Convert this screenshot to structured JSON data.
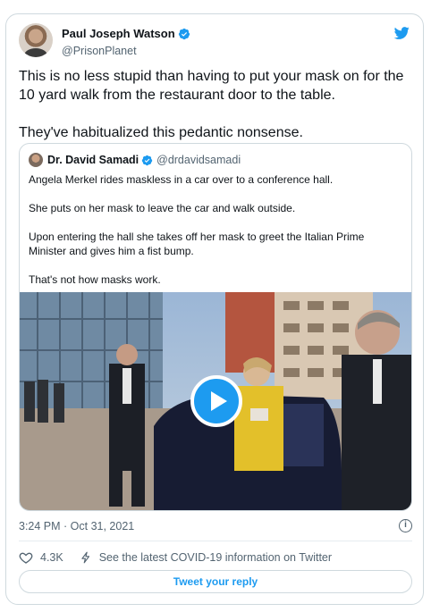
{
  "author": {
    "name": "Paul Joseph Watson",
    "handle": "@PrisonPlanet"
  },
  "tweet": {
    "paragraphs": [
      "This is no less stupid than having to put your mask on for the 10 yard walk from the restaurant door to the table.",
      "They've habitualized this pedantic nonsense."
    ],
    "timestamp": "3:24 PM · Oct 31, 2021",
    "likes": "4.3K",
    "covid_notice": "See the latest COVID-19 information on Twitter",
    "reply_label": "Tweet your reply"
  },
  "quoted": {
    "name": "Dr. David Samadi",
    "handle": "@drdavidsamadi",
    "paragraphs": [
      "Angela Merkel rides maskless in a car over to a conference hall.",
      "She puts on her mask to leave the car and walk outside.",
      "Upon entering the hall she takes off her mask to greet the Italian Prime Minister and gives him a fist bump.",
      "That's not how masks work."
    ]
  },
  "colors": {
    "accent": "#1d9bf0",
    "text": "#0f1419",
    "muted": "#536471",
    "border": "#cfd9de"
  },
  "icons": {
    "brand": "twitter-bird-icon",
    "verified": "verified-badge-icon",
    "info": "info-icon",
    "like": "heart-icon",
    "covid": "lightning-icon",
    "play": "play-icon"
  }
}
